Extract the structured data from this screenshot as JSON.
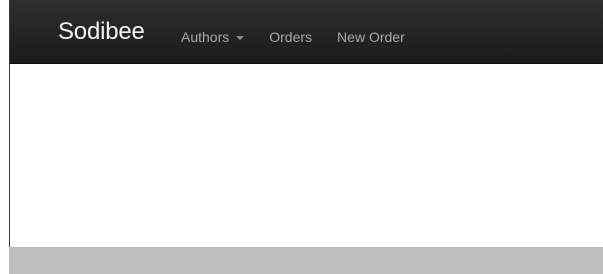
{
  "app": {
    "brand": "Sodibee"
  },
  "nav": {
    "items": [
      {
        "label": "Authors",
        "icon": "chevron-down-icon"
      },
      {
        "label": "Orders"
      },
      {
        "label": "New Order"
      }
    ]
  },
  "colors": {
    "navbar": "#1f1f1f",
    "brand_text": "#f2f2f2",
    "nav_text": "#a8a8a8",
    "content_bg": "#ffffff",
    "bottom_bar": "#bdbdbd"
  }
}
